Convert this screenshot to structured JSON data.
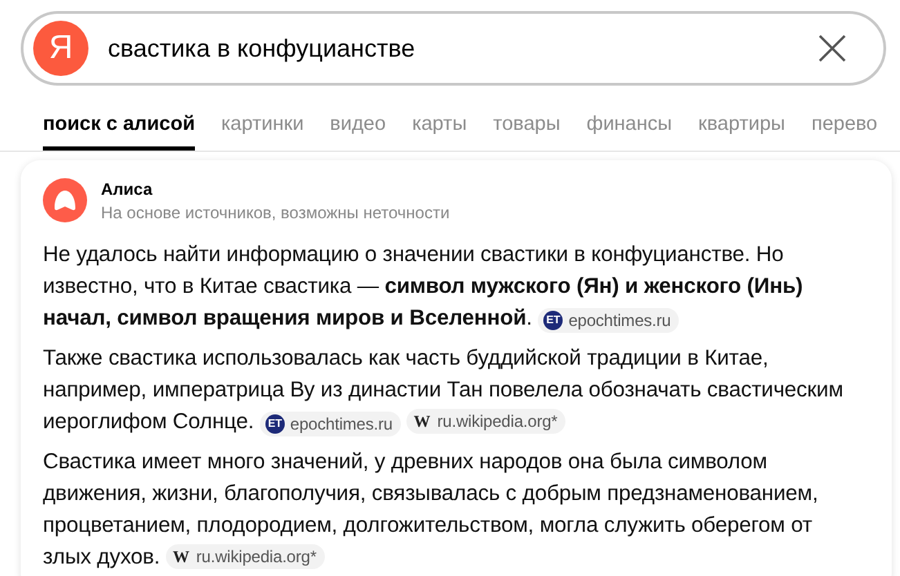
{
  "search": {
    "logo": "Я",
    "value": "свастика в конфуцианстве"
  },
  "tabs": [
    {
      "label": "поиск с алисой",
      "selected": true
    },
    {
      "label": "картинки",
      "selected": false
    },
    {
      "label": "видео",
      "selected": false
    },
    {
      "label": "карты",
      "selected": false
    },
    {
      "label": "товары",
      "selected": false
    },
    {
      "label": "финансы",
      "selected": false
    },
    {
      "label": "квартиры",
      "selected": false
    },
    {
      "label": "перево",
      "selected": false
    }
  ],
  "answer": {
    "author": "Алиса",
    "disclaimer": "На основе источников, возможны неточности",
    "paragraphs": [
      {
        "text": "Не удалось найти информацию о значении свастики в конфуцианстве. Но известно, что в Китае свастика — **символ мужского (Ян) и женского (Инь) начал, символ вращения миров и Вселенной**.",
        "sources": [
          {
            "kind": "epoch",
            "icon_text": "ET",
            "label": "epochtimes.ru"
          }
        ]
      },
      {
        "text": "Также свастика использовалась как часть буддийской традиции в Китае, например, императрица Ву из династии Тан повелела обозначать свастическим иероглифом Солнце.",
        "sources": [
          {
            "kind": "epoch",
            "icon_text": "ET",
            "label": "epochtimes.ru"
          },
          {
            "kind": "wiki",
            "icon_text": "W",
            "label": "ru.wikipedia.org*"
          }
        ]
      },
      {
        "text": "Свастика имеет много значений, у древних народов она была символом движения, жизни, благополучия, связывалась с добрым предзнаменованием, процветанием, плодородием, долгожительством, могла служить оберегом от злых духов.",
        "sources": [
          {
            "kind": "wiki",
            "icon_text": "W",
            "label": "ru.wikipedia.org*"
          }
        ]
      }
    ]
  }
}
